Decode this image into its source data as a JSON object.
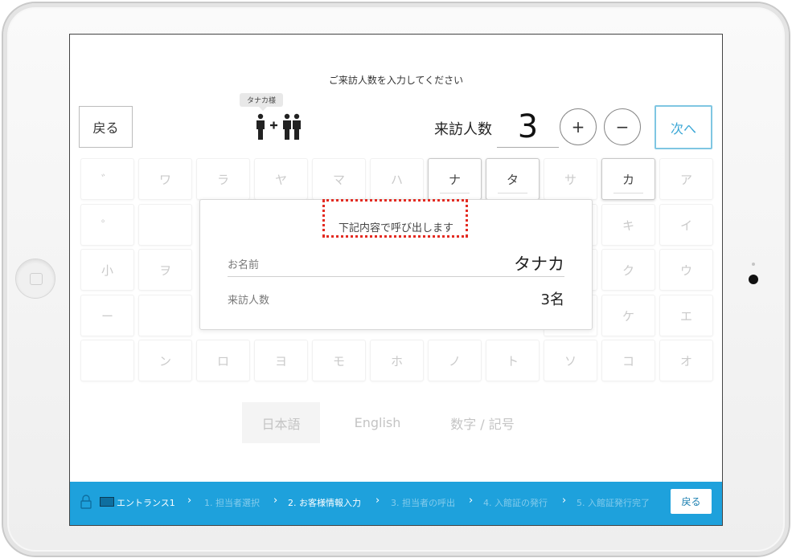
{
  "header": {
    "prompt": "ご来訪人数を入力してください",
    "back_label": "戻る",
    "tooltip_name": "タナカ様",
    "count_label": "来訪人数",
    "count_value": "3",
    "plus_label": "+",
    "minus_label": "−",
    "next_label": "次へ"
  },
  "keyboard": {
    "keys": [
      {
        "label": "゛",
        "active": false
      },
      {
        "label": "ワ",
        "active": false
      },
      {
        "label": "ラ",
        "active": false
      },
      {
        "label": "ヤ",
        "active": false
      },
      {
        "label": "マ",
        "active": false
      },
      {
        "label": "ハ",
        "active": false
      },
      {
        "label": "ナ",
        "active": true
      },
      {
        "label": "タ",
        "active": true
      },
      {
        "label": "サ",
        "active": false
      },
      {
        "label": "カ",
        "active": true
      },
      {
        "label": "ア",
        "active": false
      },
      {
        "label": "゜",
        "active": false
      },
      {
        "label": "キ",
        "active": false
      },
      {
        "label": "イ",
        "active": false
      },
      {
        "label": "小",
        "active": false
      },
      {
        "label": "ヲ",
        "active": false
      },
      {
        "label": "ク",
        "active": false
      },
      {
        "label": "ウ",
        "active": false
      },
      {
        "label": "ー",
        "active": false
      },
      {
        "label": "ケ",
        "active": false
      },
      {
        "label": "エ",
        "active": false
      },
      {
        "label": "",
        "active": false
      },
      {
        "label": "ン",
        "active": false
      },
      {
        "label": "ロ",
        "active": false
      },
      {
        "label": "ヨ",
        "active": false
      },
      {
        "label": "モ",
        "active": false
      },
      {
        "label": "ホ",
        "active": false
      },
      {
        "label": "ノ",
        "active": false
      },
      {
        "label": "ト",
        "active": false
      },
      {
        "label": "ソ",
        "active": false
      },
      {
        "label": "コ",
        "active": false
      },
      {
        "label": "オ",
        "active": false
      }
    ]
  },
  "languages": {
    "japanese": "日本語",
    "english": "English",
    "numbers": "数字 / 記号",
    "selected": "japanese"
  },
  "modal": {
    "title": "下記内容で呼び出します",
    "name_label": "お名前",
    "name_value": "タナカ",
    "count_label": "来訪人数",
    "count_value": "3名"
  },
  "footer": {
    "location": "エントランス1",
    "steps": [
      {
        "label": "1. 担当者選択",
        "current": false
      },
      {
        "label": "2. お客様情報入力",
        "current": true
      },
      {
        "label": "3. 担当者の呼出",
        "current": false
      },
      {
        "label": "4. 入館証の発行",
        "current": false
      },
      {
        "label": "5. 入館証発行完了",
        "current": false
      }
    ],
    "separator": "›",
    "back_label": "戻る"
  },
  "colors": {
    "footer_bg": "#1ea1dc",
    "accent": "#3ba7d6",
    "highlight": "#e32b22"
  }
}
